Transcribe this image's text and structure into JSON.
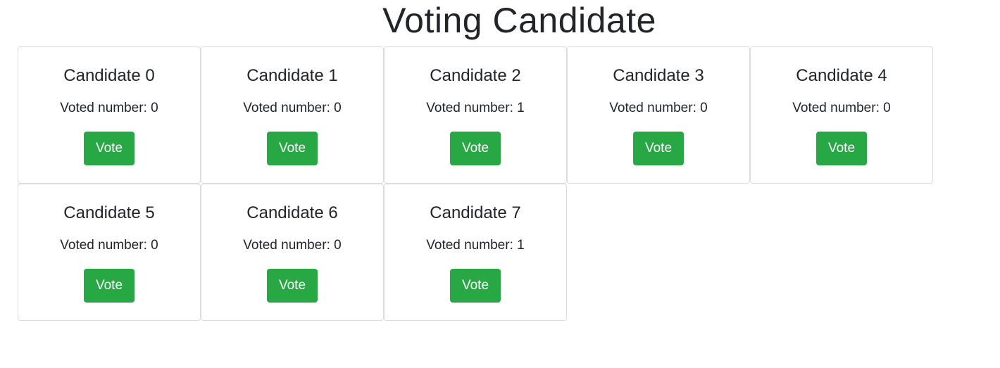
{
  "page": {
    "title": "Voting Candidate"
  },
  "colors": {
    "vote_button": "#28a745",
    "card_border": "#dcdcdc",
    "text": "#212529"
  },
  "votes_prefix": "Voted number: ",
  "vote_button_label": "Vote",
  "candidates": [
    {
      "name": "Candidate 0",
      "votes": 0
    },
    {
      "name": "Candidate 1",
      "votes": 0
    },
    {
      "name": "Candidate 2",
      "votes": 1
    },
    {
      "name": "Candidate 3",
      "votes": 0
    },
    {
      "name": "Candidate 4",
      "votes": 0
    },
    {
      "name": "Candidate 5",
      "votes": 0
    },
    {
      "name": "Candidate 6",
      "votes": 0
    },
    {
      "name": "Candidate 7",
      "votes": 1
    }
  ]
}
